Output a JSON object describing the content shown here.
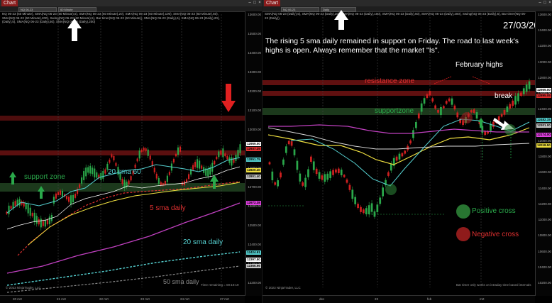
{
  "left": {
    "window_title": "Chart",
    "instrument": "NQ 06-23",
    "interval": "60 Minute",
    "legend_lines": [
      "NQ 06-23 (60 Minute), SMA(NQ 06-23 (60 Minute),5), SMA(NQ 06-23 (60 Minute),20), SMA(NQ 06-23 (60 Minute),100), SMA(NQ 06-23 (60 Minute),50),",
      "SMA(NQ 06-23 (60 Minute),200), Swing(NQ 06-23 (60 Minute),5), Bar timer(NQ 06-23 (60 Minute)), SMA(NQ 06-23 (Daily),5), SMA(NQ 06-23 (Daily),20),",
      "(Daily),5), SMA(NQ 06-23 (Daily),50), SMA(NQ 06-23 (Daily),200)"
    ],
    "price_ticks": [
      "13600.00",
      "13500.00",
      "13400.00",
      "13300.00",
      "13200.00",
      "13100.00",
      "13000.00",
      "12900.00",
      "12800.00",
      "12700.00",
      "12600.00",
      "12500.00",
      "12400.00",
      "12300.00",
      "12200.00"
    ],
    "price_tags": [
      {
        "text": "12959.00",
        "color": "#ffffff"
      },
      {
        "text": "12937.25",
        "color": "#e03030"
      },
      {
        "text": "12851.75",
        "color": "#55d0d0"
      },
      {
        "text": "12820.40",
        "color": "#f0e040"
      },
      {
        "text": "12801.40",
        "color": "#cccccc"
      },
      {
        "text": "12672.38",
        "color": "#e040e0"
      },
      {
        "text": "12424.91",
        "color": "#55d0d0"
      },
      {
        "text": "12397.50",
        "color": "#ffffff"
      },
      {
        "text": "12366.96",
        "color": "#cccccc"
      }
    ],
    "time_ticks": [
      "20 mrt",
      "21 mrt",
      "22 mrt",
      "23 mrt",
      "24 mrt",
      "27 mrt"
    ],
    "annotations": {
      "support_zone": "support zone",
      "sma20_60": "20 sma 60",
      "sma5_daily": "5 sma daily",
      "sma20_daily": "20 sma daily",
      "sma50_daily": "50 sma daily"
    },
    "footer_left": "© 2023 NinjaTrader, LLC",
    "footer_right": "Time remaining = 00:10:19",
    "colors": {
      "up": "#2aa84a",
      "down": "#d02020",
      "sma5": "#e03030",
      "sma20": "#55d0d0",
      "sma50": "#f0e040",
      "sma200": "#c040c0"
    }
  },
  "right": {
    "window_title": "Chart",
    "instrument": "NQ 06-23",
    "interval": "Daily",
    "legend_lines": [
      "SMA(NQ 06-23 (Daily),5), SMA(NQ 06-23 (Daily),20), SMA(NQ 06-23 (Daily),100), SMA(NQ 06-23 (Daily),50), SMA(NQ 06-23 (Daily),200), Swing(NQ 06-23 (Daily),5), Bar timer(NQ 06-23 (Daily)),"
    ],
    "date": "27/03/2023",
    "commentary": "The rising 5 sma daily remained in support on Friday. The road to last week's highs is open. Always remember that the market \"Is\".",
    "annotations": {
      "february_highs": "February highs",
      "resistance_zone": "resistance zone",
      "support_zone": "supportzone",
      "break": "break",
      "positive_cross": "Positive cross",
      "negative_cross": "Negative cross"
    },
    "price_ticks": [
      "13600.00",
      "13400.00",
      "13200.00",
      "13000.00",
      "12800.00",
      "12600.00",
      "12400.00",
      "12200.00",
      "12000.00",
      "11800.00",
      "11600.00",
      "11400.00",
      "11200.00",
      "11000.00",
      "10800.00",
      "10600.00",
      "10400.00",
      "10200.00"
    ],
    "price_tags": [
      {
        "text": "12959.00",
        "color": "#ffffff"
      },
      {
        "text": "12895.05",
        "color": "#e03030"
      },
      {
        "text": "12482.15",
        "color": "#55d0d0"
      },
      {
        "text": "12301.00",
        "color": "#cccccc"
      },
      {
        "text": "12174.00",
        "color": "#e040e0"
      },
      {
        "text": "12018.50",
        "color": "#f0e040"
      }
    ],
    "time_ticks": [
      "dec",
      "23",
      "feb",
      "mrt"
    ],
    "footer_left": "© 2023 NinjaTrader, LLC",
    "footer_right": "Bar timer only works on intraday time based intervals",
    "colors": {
      "up": "#2aa84a",
      "down": "#d02020",
      "sma5": "#e03030",
      "sma20": "#55d0d0",
      "sma50": "#f0e040",
      "sma200": "#c040c0",
      "positive": "#2f8a3a",
      "negative": "#a82020"
    }
  }
}
